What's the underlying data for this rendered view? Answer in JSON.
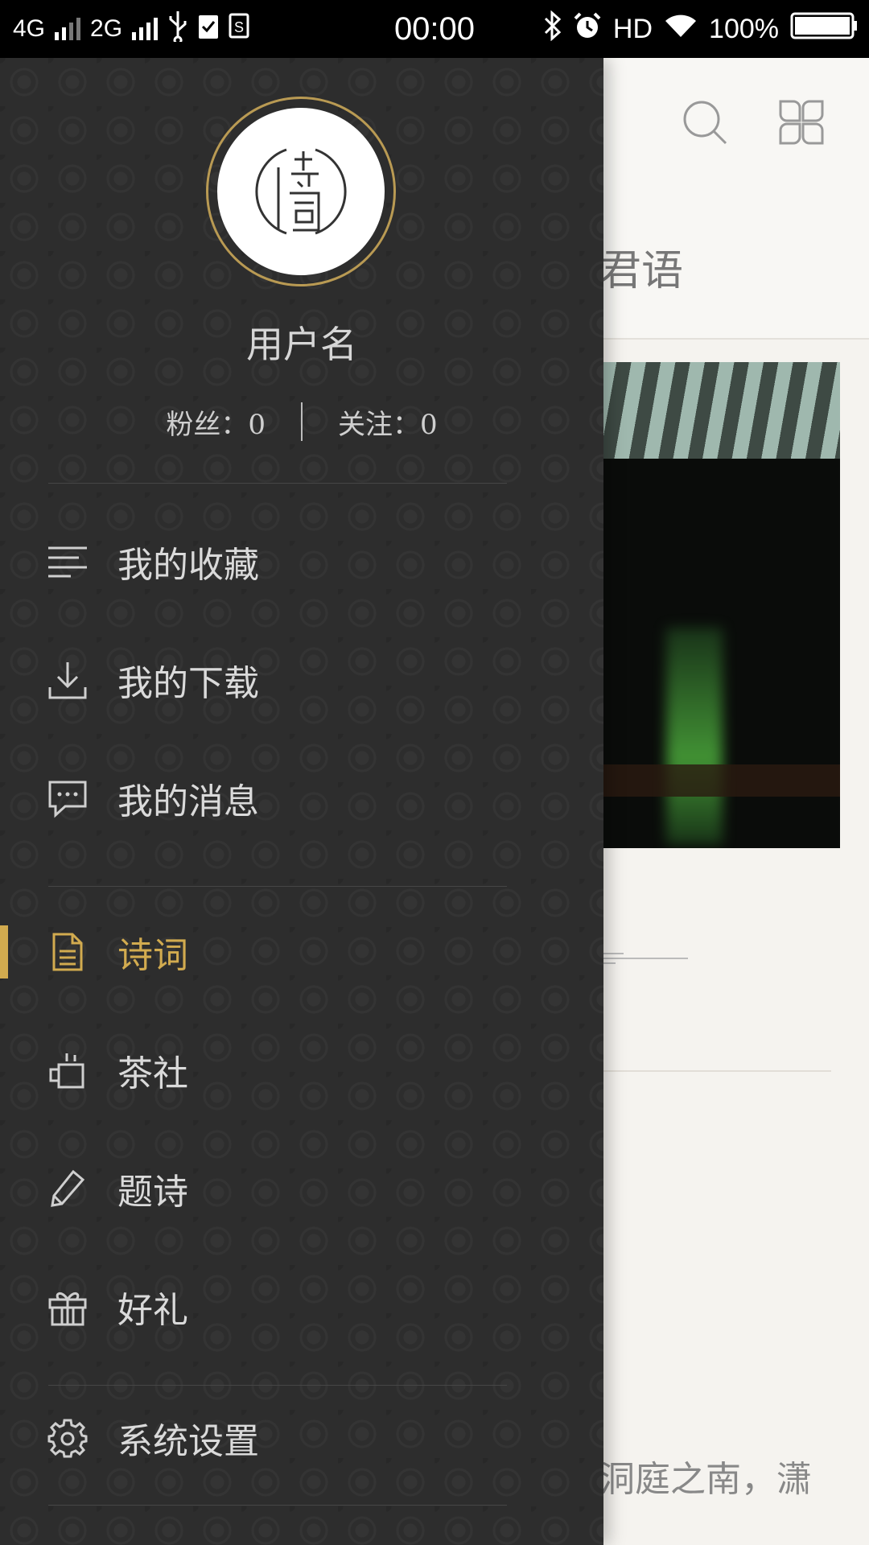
{
  "status_bar": {
    "net1": "4G",
    "net2": "2G",
    "time": "00:00",
    "hd": "HD",
    "battery": "100%"
  },
  "background_app": {
    "title_fragment": "君语",
    "excerpt_fragment": "洞庭之南，潇",
    "icons": [
      "search-icon",
      "grid-icon"
    ]
  },
  "drawer": {
    "username": "用户名",
    "fans": "粉丝：0",
    "following": "关注：0",
    "section1": [
      {
        "label": "我的收藏",
        "icon": "list-icon"
      },
      {
        "label": "我的下载",
        "icon": "download-icon"
      },
      {
        "label": "我的消息",
        "icon": "message-icon"
      }
    ],
    "section2": [
      {
        "label": "诗词",
        "icon": "document-icon",
        "active": true
      },
      {
        "label": "茶社",
        "icon": "teacup-icon"
      },
      {
        "label": "题诗",
        "icon": "pen-icon"
      },
      {
        "label": "好礼",
        "icon": "gift-icon"
      }
    ],
    "settings": {
      "label": "系统设置",
      "icon": "gear-icon"
    }
  },
  "colors": {
    "drawer_bg": "#2d2d2d",
    "accent_gold": "#d2ab4f",
    "text_light": "#dadada"
  }
}
